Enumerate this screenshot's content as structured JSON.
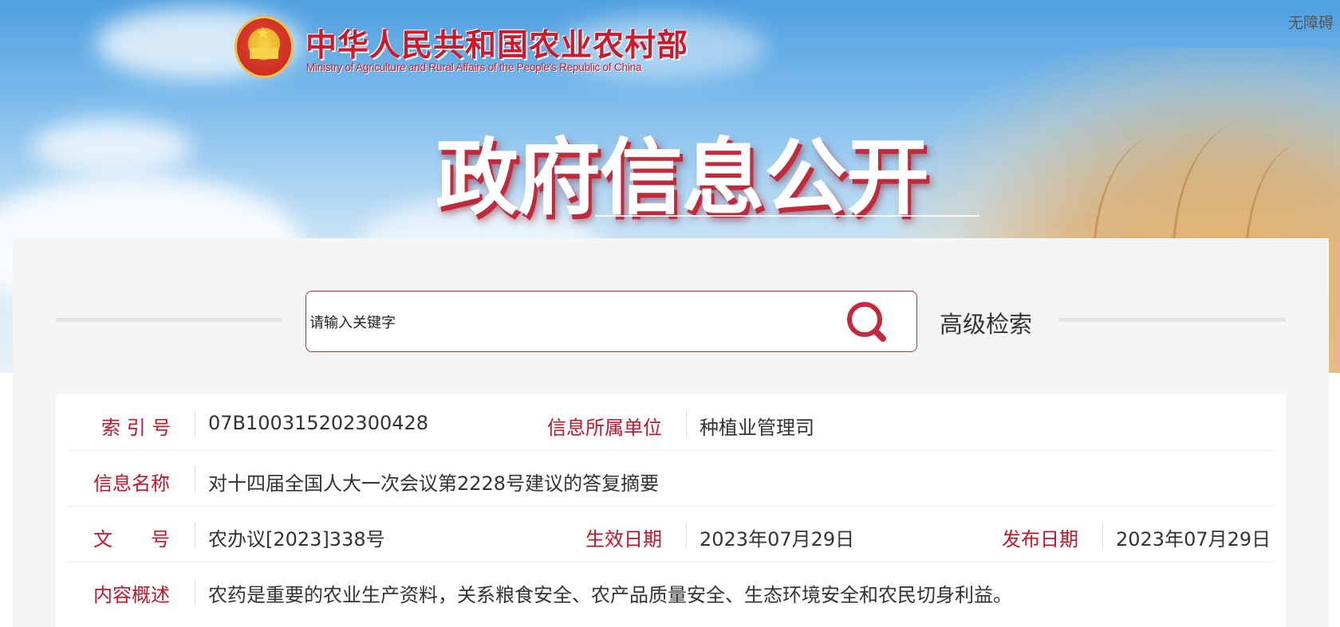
{
  "header": {
    "ministry_name_cn": "中华人民共和国农业农村部",
    "ministry_name_en": "Ministry of Agriculture and Rural Affairs of the People's Republic of China",
    "banner_title": "政府信息公开",
    "accessibility_link": "无障碍"
  },
  "search": {
    "placeholder": "请输入关键字",
    "search_icon": "search-icon",
    "advanced_search_label": "高级检索"
  },
  "info": {
    "index_label": "索 引 号",
    "index_value": "07B100315202300428",
    "unit_label": "信息所属单位",
    "unit_value": "种植业管理司",
    "name_label": "信息名称",
    "name_value": "对十四届全国人大一次会议第2228号建议的答复摘要",
    "doc_no_label": "文　　号",
    "doc_no_value": "农办议[2023]338号",
    "effective_date_label": "生效日期",
    "effective_date_value": "2023年07月29日",
    "publish_date_label": "发布日期",
    "publish_date_value": "2023年07月29日",
    "summary_label": "内容概述",
    "summary_value": "农药是重要的农业生产资料，关系粮食安全、农产品质量安全、生态环境安全和农民切身利益。"
  },
  "colors": {
    "brand_red": "#c0162a",
    "panel_bg": "#f5f5f5",
    "text_dark": "#333333"
  }
}
